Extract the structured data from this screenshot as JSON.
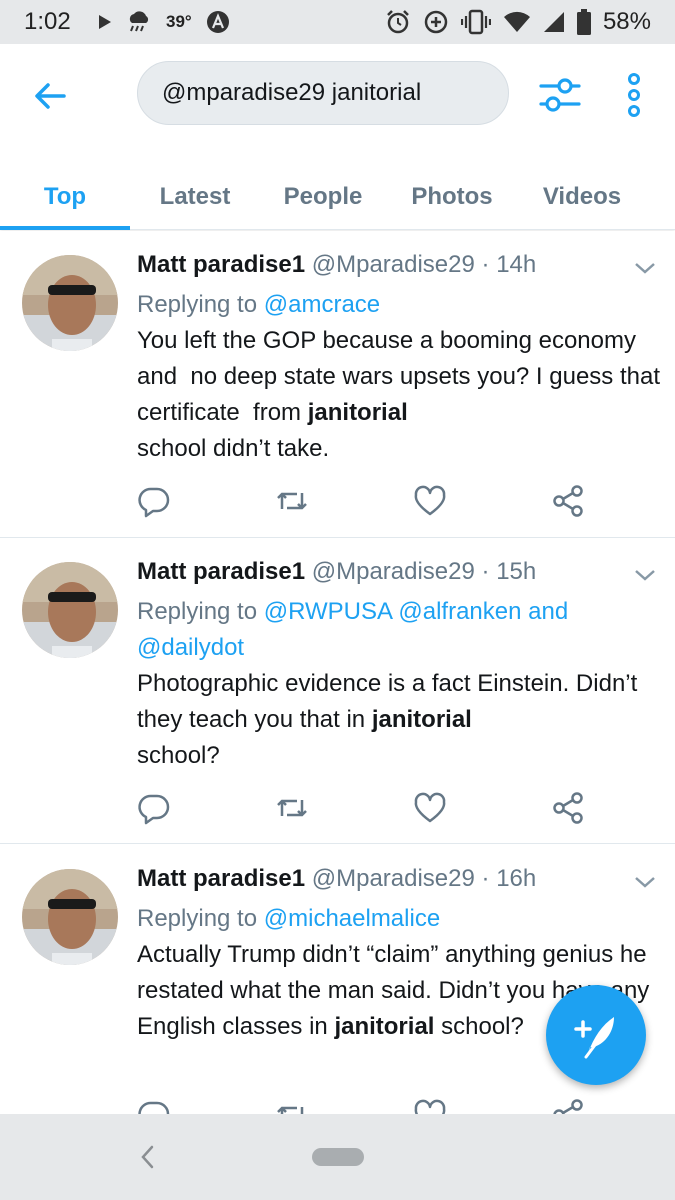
{
  "status_bar": {
    "time": "1:02",
    "temperature": "39°",
    "battery": "58%",
    "icons": [
      "play-icon",
      "rain-cloud-icon",
      "a-circle-icon",
      "alarm-icon",
      "data-saver-icon",
      "vibrate-icon",
      "wifi-icon",
      "signal-icon",
      "battery-icon"
    ]
  },
  "search": {
    "query": "@mparadise29 janitorial"
  },
  "tabs": [
    {
      "label": "Top",
      "active": true
    },
    {
      "label": "Latest",
      "active": false
    },
    {
      "label": "People",
      "active": false
    },
    {
      "label": "Photos",
      "active": false
    },
    {
      "label": "Videos",
      "active": false
    }
  ],
  "tweets": [
    {
      "name": "Matt paradise1",
      "handle": "@Mparadise29",
      "dot": "·",
      "time": "14h",
      "replying_prefix": "Replying to ",
      "mentions": "@amcrace",
      "body_before": "You left the GOP because a booming economy and  no deep state wars upsets you? I guess that certificate  from ",
      "body_bold": "janitorial",
      "body_after": "\nschool didn’t take."
    },
    {
      "name": "Matt paradise1",
      "handle": "@Mparadise29",
      "dot": "·",
      "time": "15h",
      "replying_prefix": "Replying to ",
      "mentions": "@RWPUSA @alfranken and @dailydot",
      "body_before": "Photographic evidence is a fact Einstein. Didn’t  they teach you that in ",
      "body_bold": "janitorial",
      "body_after": "\nschool?"
    },
    {
      "name": "Matt paradise1",
      "handle": "@Mparadise29",
      "dot": "·",
      "time": "16h",
      "replying_prefix": "Replying to ",
      "mentions": "@michaelmalice",
      "body_before": "Actually Trump didn’t “claim” anything genius he restated what the man said. Didn’t you have any English classes in ",
      "body_bold": "janitorial",
      "body_after": " school?"
    }
  ],
  "colors": {
    "accent": "#1da1f2",
    "secondary_text": "#657786",
    "primary_text": "#14171a",
    "divider": "#e1e8ed"
  }
}
